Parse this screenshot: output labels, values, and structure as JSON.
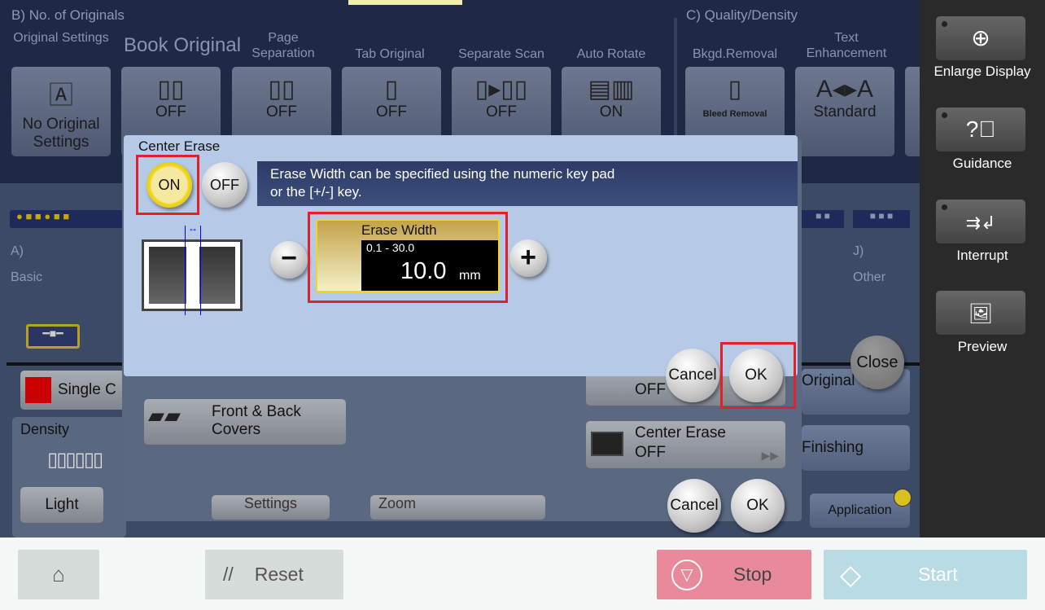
{
  "background": {
    "section_b": "B)   No. of Originals",
    "section_c": "C)   Quality/Density",
    "functions": [
      {
        "label": "Original Settings",
        "value": "No Original Settings"
      },
      {
        "label": "Book Original",
        "value": "OFF"
      },
      {
        "label": "Page Separation",
        "value": "OFF"
      },
      {
        "label": "Tab Original",
        "value": "OFF"
      },
      {
        "label": "Separate Scan",
        "value": "OFF"
      },
      {
        "label": "Auto Rotate",
        "value": "ON"
      },
      {
        "label": "Bkgd.Removal",
        "value": "Bleed Removal"
      },
      {
        "label": "Text Enhancement",
        "value": "Standard"
      }
    ],
    "tab_a": "A)",
    "tab_a_name": "Basic",
    "tab_j": "J)",
    "tab_j_name": "Other",
    "color_button": "Single C",
    "density_label": "Density",
    "light_button": "Light",
    "front_back_covers": "Front & Back Covers",
    "settings_partial": "Settings",
    "zoom_partial": "Zoom",
    "frame_erase_value": "OFF",
    "center_erase_title": "Center Erase",
    "center_erase_value": "OFF",
    "original_type": "Original Type",
    "finishing": "Finishing",
    "application": "Application",
    "close": "Close",
    "cancel": "Cancel",
    "ok": "OK"
  },
  "sidebar": [
    {
      "label": "Enlarge Display",
      "icon": "zoom-in-icon"
    },
    {
      "label": "Guidance",
      "icon": "question-icon"
    },
    {
      "label": "Interrupt",
      "icon": "interrupt-icon"
    },
    {
      "label": "Preview",
      "icon": "preview-icon"
    }
  ],
  "dialog": {
    "title": "Center Erase",
    "on_label": "ON",
    "off_label": "OFF",
    "selected": "ON",
    "info_line1": "Erase Width can be specified using the numeric key pad",
    "info_line2": "or the [+/-] key.",
    "field_label": "Erase Width",
    "range": "0.1 - 30.0",
    "value": "10.0",
    "unit": "mm",
    "cancel": "Cancel",
    "ok": "OK"
  },
  "bottom": {
    "reset": "Reset",
    "stop": "Stop",
    "start": "Start"
  },
  "colors": {
    "highlight": "#e0202a",
    "on_yellow": "#f0d820",
    "stop": "#e98a9c",
    "start": "#b9dce4"
  }
}
